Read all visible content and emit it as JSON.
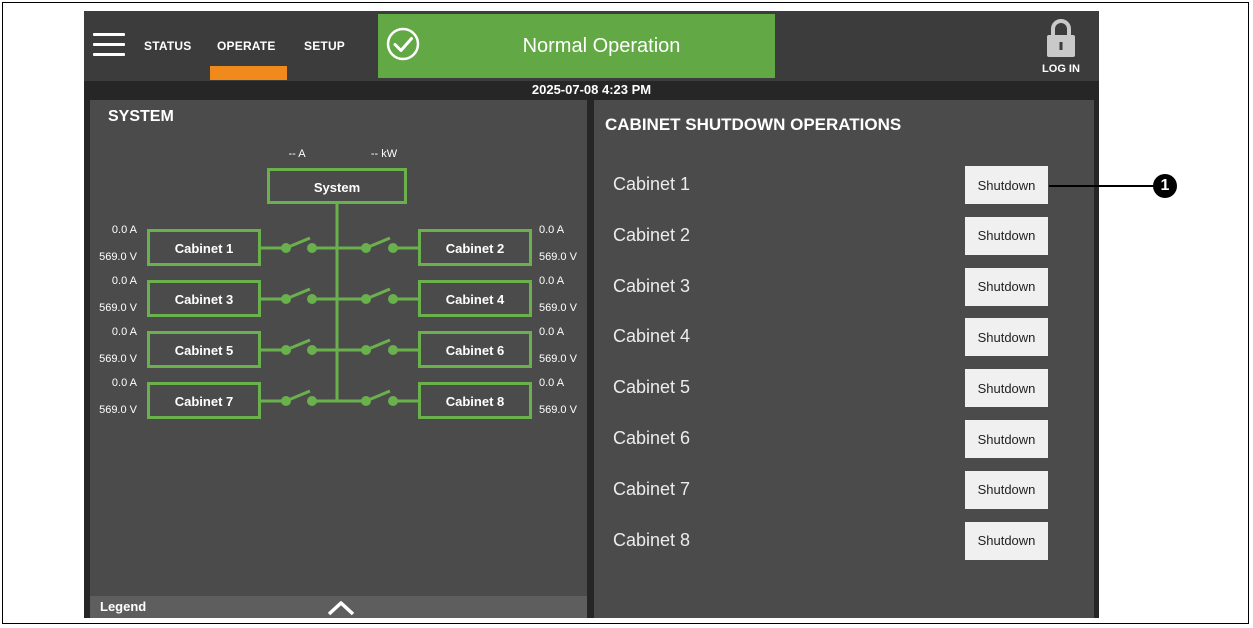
{
  "nav": {
    "tabs": [
      {
        "label": "STATUS"
      },
      {
        "label": "OPERATE",
        "active": true
      },
      {
        "label": "SETUP"
      }
    ]
  },
  "status": {
    "text": "Normal Operation",
    "color": "#62a845"
  },
  "login": {
    "label": "LOG IN"
  },
  "datetime": "2025-07-08 4:23 PM",
  "system": {
    "title": "SYSTEM",
    "current": "-- A",
    "power": "-- kW",
    "node_label": "System",
    "cabinets": [
      {
        "label": "Cabinet 1",
        "current": "0.0 A",
        "voltage": "569.0 V"
      },
      {
        "label": "Cabinet 2",
        "current": "0.0 A",
        "voltage": "569.0 V"
      },
      {
        "label": "Cabinet 3",
        "current": "0.0 A",
        "voltage": "569.0 V"
      },
      {
        "label": "Cabinet 4",
        "current": "0.0 A",
        "voltage": "569.0 V"
      },
      {
        "label": "Cabinet 5",
        "current": "0.0 A",
        "voltage": "569.0 V"
      },
      {
        "label": "Cabinet 6",
        "current": "0.0 A",
        "voltage": "569.0 V"
      },
      {
        "label": "Cabinet 7",
        "current": "0.0 A",
        "voltage": "569.0 V"
      },
      {
        "label": "Cabinet 8",
        "current": "0.0 A",
        "voltage": "569.0 V"
      }
    ]
  },
  "legend": {
    "label": "Legend"
  },
  "shutdown_ops": {
    "title": "CABINET SHUTDOWN OPERATIONS",
    "rows": [
      {
        "label": "Cabinet 1",
        "button": "Shutdown"
      },
      {
        "label": "Cabinet 2",
        "button": "Shutdown"
      },
      {
        "label": "Cabinet 3",
        "button": "Shutdown"
      },
      {
        "label": "Cabinet 4",
        "button": "Shutdown"
      },
      {
        "label": "Cabinet 5",
        "button": "Shutdown"
      },
      {
        "label": "Cabinet 6",
        "button": "Shutdown"
      },
      {
        "label": "Cabinet 7",
        "button": "Shutdown"
      },
      {
        "label": "Cabinet 8",
        "button": "Shutdown"
      }
    ]
  },
  "callout": {
    "number": "1"
  },
  "colors": {
    "accent": "#f08a1d",
    "line_green": "#6ab04c",
    "panel": "#4b4b4b"
  }
}
